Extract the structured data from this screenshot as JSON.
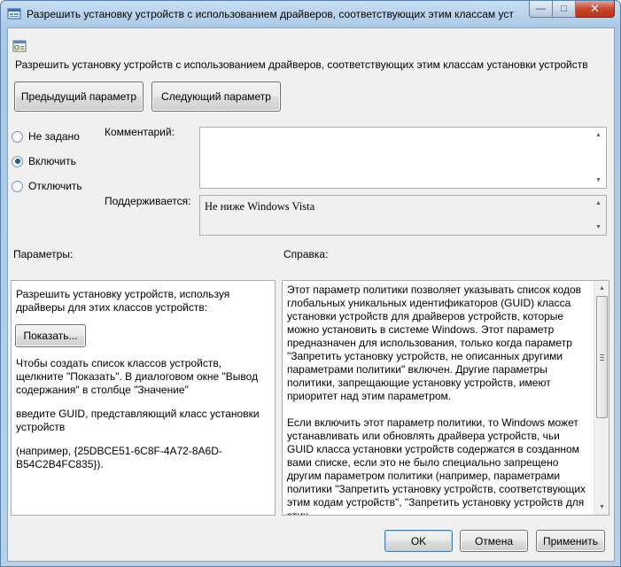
{
  "window": {
    "title": "Разрешить установку устройств с использованием драйверов, соответствующих этим классам уста...",
    "minimize_glyph": "—",
    "maximize_glyph": "□",
    "close_glyph": "✕"
  },
  "policy": {
    "icon": "policy-setting-icon",
    "title": "Разрешить установку устройств с использованием драйверов, соответствующих этим классам установки устройств"
  },
  "nav": {
    "prev_label": "Предыдущий параметр",
    "next_label": "Следующий параметр"
  },
  "state": {
    "options": [
      {
        "label": "Не задано",
        "selected": false
      },
      {
        "label": "Включить",
        "selected": true
      },
      {
        "label": "Отключить",
        "selected": false
      }
    ]
  },
  "comment": {
    "label": "Комментарий:",
    "value": ""
  },
  "supported": {
    "label": "Поддерживается:",
    "value": "Не ниже Windows Vista"
  },
  "options_panel": {
    "label": "Параметры:",
    "intro": "Разрешить установку устройств, используя драйверы для этих классов устройств:",
    "show_button": "Показать...",
    "para1": "Чтобы создать список классов устройств, щелкните \"Показать\". В диалоговом окне \"Вывод содержания\" в столбце \"Значение\"",
    "para2": "введите GUID, представляющий класс установки устройств",
    "para3": "(например, {25DBCE51-6C8F-4A72-8A6D-B54C2B4FC835})."
  },
  "help_panel": {
    "label": "Справка:",
    "para1": "Этот параметр политики позволяет указывать список кодов глобальных уникальных идентификаторов (GUID) класса установки устройств для драйверов устройств, которые можно установить в системе Windows. Этот параметр предназначен для использования, только когда параметр \"Запретить установку устройств, не описанных другими параметрами политики\" включен.  Другие параметры политики, запрещающие установку устройств, имеют приоритет над этим параметром.",
    "para2": "Если включить этот параметр политики, то Windows может устанавливать или обновлять драйвера устройств, чьи GUID класса установки устройств содержатся в созданном вами списке, если это не было специально запрещено другим параметром политики (например, параметрами политики \"Запретить установку устройств, соответствующих этим кодам устройств\", \"Запретить установку устройств для этих"
  },
  "footer": {
    "ok_label": "OK",
    "cancel_label": "Отмена",
    "apply_label": "Применить"
  }
}
